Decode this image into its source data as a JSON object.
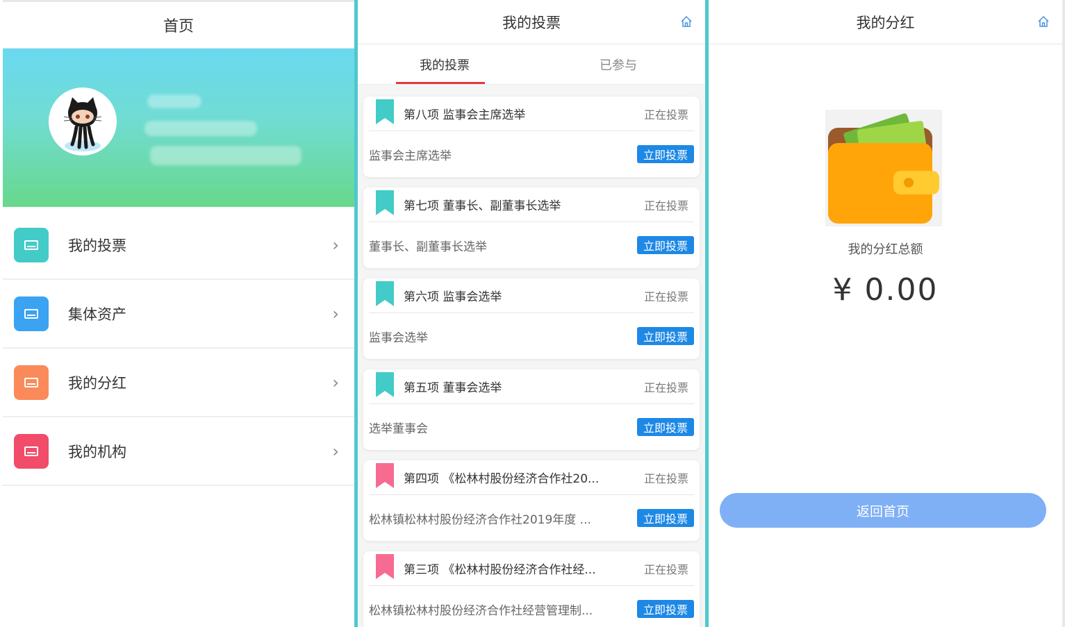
{
  "panel_home": {
    "title": "首页",
    "menu": [
      {
        "label": "我的投票",
        "icon": "card-icon",
        "color": "#43cbc8"
      },
      {
        "label": "集体资产",
        "icon": "card-icon",
        "color": "#3aa3f2"
      },
      {
        "label": "我的分红",
        "icon": "card-icon",
        "color": "#fb8a5a"
      },
      {
        "label": "我的机构",
        "icon": "card-icon",
        "color": "#f14c6a"
      }
    ],
    "chevron": "›"
  },
  "panel_votes": {
    "title": "我的投票",
    "tabs": [
      {
        "label": "我的投票",
        "active": true
      },
      {
        "label": "已参与",
        "active": false
      }
    ],
    "items": [
      {
        "title": "第八项 监事会主席选举",
        "status": "正在投票",
        "desc": "监事会主席选举",
        "button": "立即投票",
        "ribbon_color": "#43cbc8"
      },
      {
        "title": "第七项 董事长、副董事长选举",
        "status": "正在投票",
        "desc": "董事长、副董事长选举",
        "button": "立即投票",
        "ribbon_color": "#43cbc8"
      },
      {
        "title": "第六项 监事会选举",
        "status": "正在投票",
        "desc": "监事会选举",
        "button": "立即投票",
        "ribbon_color": "#43cbc8"
      },
      {
        "title": "第五项 董事会选举",
        "status": "正在投票",
        "desc": "选举董事会",
        "button": "立即投票",
        "ribbon_color": "#43cbc8"
      },
      {
        "title": "第四项 《松林村股份经济合作社20...",
        "status": "正在投票",
        "desc": "松林镇松林村股份经济合作社2019年度 ...",
        "button": "立即投票",
        "ribbon_color": "#f76b93"
      },
      {
        "title": "第三项 《松林村股份经济合作社经...",
        "status": "正在投票",
        "desc": "松林镇松林村股份经济合作社经营管理制...",
        "button": "立即投票",
        "ribbon_color": "#f76b93"
      }
    ]
  },
  "panel_dividend": {
    "title": "我的分红",
    "total_label": "我的分红总额",
    "amount": "¥ 0.00",
    "back_button": "返回首页"
  },
  "colors": {
    "accent_blue": "#1e88e5",
    "tab_underline": "#e53935",
    "divider": "#4ec8cf"
  }
}
